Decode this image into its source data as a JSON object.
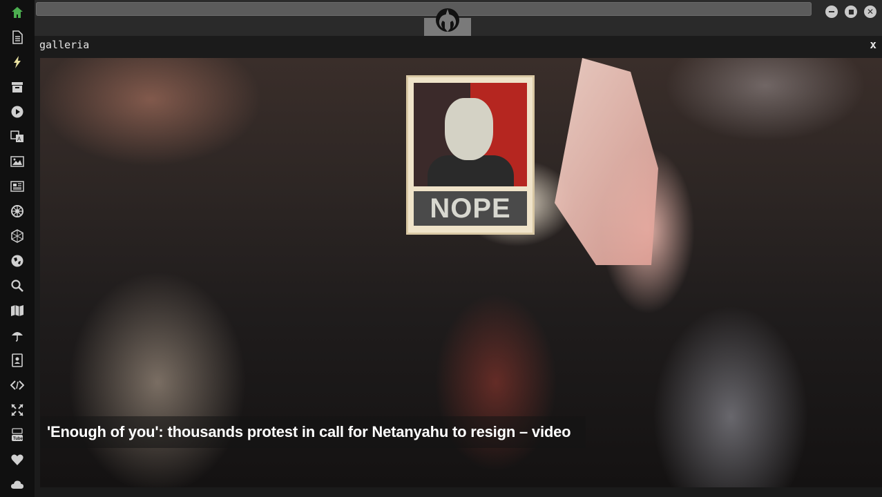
{
  "sidebar": {
    "icons": [
      {
        "name": "home-icon",
        "color": "#4caf50"
      },
      {
        "name": "document-icon",
        "color": "#d0d0d0"
      },
      {
        "name": "lightning-icon",
        "color": "#e8e0a0"
      },
      {
        "name": "archive-icon",
        "color": "#d0d0d0"
      },
      {
        "name": "play-circle-icon",
        "color": "#d0d0d0"
      },
      {
        "name": "translate-icon",
        "color": "#d0d0d0"
      },
      {
        "name": "image-icon",
        "color": "#d0d0d0"
      },
      {
        "name": "newspaper-icon",
        "color": "#d0d0d0"
      },
      {
        "name": "empire-icon",
        "color": "#d0d0d0"
      },
      {
        "name": "hexagon-network-icon",
        "color": "#d0d0d0"
      },
      {
        "name": "globe-icon",
        "color": "#d0d0d0"
      },
      {
        "name": "search-icon",
        "color": "#d0d0d0"
      },
      {
        "name": "map-icon",
        "color": "#d0d0d0"
      },
      {
        "name": "umbrella-icon",
        "color": "#d0d0d0"
      },
      {
        "name": "contact-card-icon",
        "color": "#d0d0d0"
      },
      {
        "name": "code-icon",
        "color": "#d0d0d0"
      },
      {
        "name": "expand-arrows-icon",
        "color": "#d0d0d0"
      },
      {
        "name": "youtube-icon",
        "color": "#d0d0d0"
      },
      {
        "name": "heart-icon",
        "color": "#d0d0d0"
      },
      {
        "name": "cloud-icon",
        "color": "#d0d0d0"
      }
    ]
  },
  "header": {
    "logo": "rebel-alliance-icon",
    "window_controls": [
      "minimize-icon",
      "maximize-icon",
      "close-icon"
    ]
  },
  "panel": {
    "title": "galleria",
    "close_label": "x"
  },
  "gallery": {
    "poster_word": "NOPE",
    "caption": "'Enough of you': thousands protest in call for Netanyahu to resign – video"
  },
  "colors": {
    "accent": "#4caf50",
    "background": "#1b1b1b",
    "sidebar": "#101010"
  }
}
